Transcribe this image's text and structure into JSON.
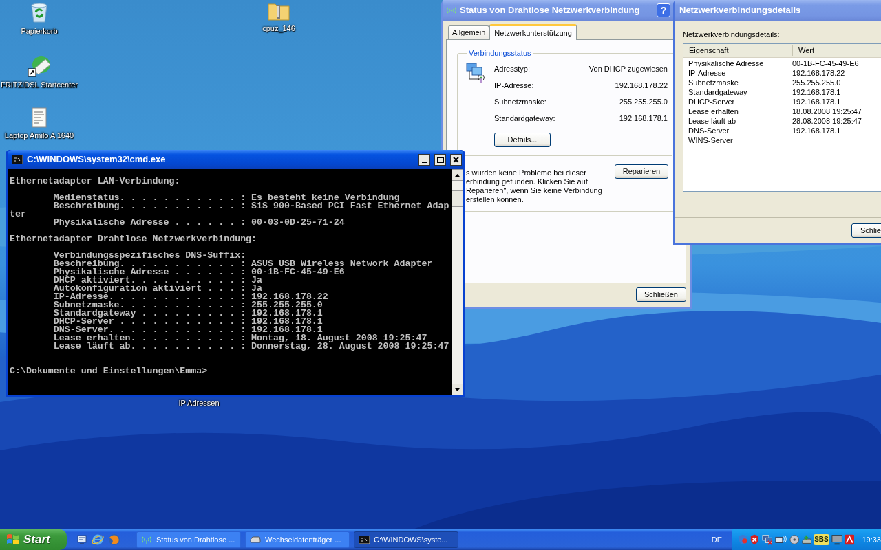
{
  "desktop": {
    "icons": [
      {
        "label": "Papierkorb",
        "kind": "recycle"
      },
      {
        "label": "cpuz_146",
        "kind": "zip"
      },
      {
        "label": "FRITZ!DSL Startcenter",
        "kind": "shortcut"
      },
      {
        "label": "Laptop Amilo A 1640",
        "kind": "document"
      },
      {
        "label": "IP Adressen",
        "kind": "hidden"
      }
    ]
  },
  "status_window": {
    "title": "Status von Drahtlose Netzwerkverbindung",
    "active": false,
    "help_button": "?",
    "tabs": [
      {
        "label": "Allgemein",
        "selected": false
      },
      {
        "label": "Netzwerkunterstützung",
        "selected": true
      }
    ],
    "group_title": "Verbindungsstatus",
    "fields": [
      {
        "label": "Adresstyp:",
        "value": "Von DHCP zugewiesen"
      },
      {
        "label": "IP-Adresse:",
        "value": "192.168.178.22"
      },
      {
        "label": "Subnetzmaske:",
        "value": "255.255.255.0"
      },
      {
        "label": "Standardgateway:",
        "value": "192.168.178.1"
      }
    ],
    "details_button": "Details...",
    "problem_text": [
      "s wurden keine Probleme bei dieser",
      "erbindung gefunden. Klicken Sie auf",
      "Reparieren\", wenn Sie keine Verbindung",
      "erstellen können."
    ],
    "repair_button": "Reparieren",
    "close_button": "Schließen"
  },
  "details_window": {
    "title": "Netzwerkverbindungsdetails",
    "active": false,
    "caption": "Netzwerkverbindungsdetails:",
    "columns": [
      "Eigenschaft",
      "Wert"
    ],
    "rows": [
      {
        "property": "Physikalische Adresse",
        "value": "00-1B-FC-45-49-E6"
      },
      {
        "property": "IP-Adresse",
        "value": "192.168.178.22"
      },
      {
        "property": "Subnetzmaske",
        "value": "255.255.255.0"
      },
      {
        "property": "Standardgateway",
        "value": "192.168.178.1"
      },
      {
        "property": "DHCP-Server",
        "value": "192.168.178.1"
      },
      {
        "property": "Lease erhalten",
        "value": "18.08.2008 19:25:47"
      },
      {
        "property": "Lease läuft ab",
        "value": "28.08.2008 19:25:47"
      },
      {
        "property": "DNS-Server",
        "value": "192.168.178.1"
      },
      {
        "property": "WINS-Server"
      }
    ],
    "close_button": "Schlie"
  },
  "console_window": {
    "title": "C:\\WINDOWS\\system32\\cmd.exe",
    "active": true,
    "output": "Ethernetadapter LAN-Verbindung:\n\n        Medienstatus. . . . . . . . . . . : Es besteht keine Verbindung\n        Beschreibung. . . . . . . . . . . : SiS 900-Based PCI Fast Ethernet Adap\nter\n        Physikalische Adresse . . . . . . : 00-03-0D-25-71-24\n\nEthernetadapter Drahtlose Netzwerkverbindung:\n\n        Verbindungsspezifisches DNS-Suffix:\n        Beschreibung. . . . . . . . . . . : ASUS USB Wireless Network Adapter\n        Physikalische Adresse . . . . . . : 00-1B-FC-45-49-E6\n        DHCP aktiviert. . . . . . . . . . : Ja\n        Autokonfiguration aktiviert . . . : Ja\n        IP-Adresse. . . . . . . . . . . . : 192.168.178.22\n        Subnetzmaske. . . . . . . . . . . : 255.255.255.0\n        Standardgateway . . . . . . . . . : 192.168.178.1\n        DHCP-Server . . . . . . . . . . . : 192.168.178.1\n        DNS-Server. . . . . . . . . . . . : 192.168.178.1\n        Lease erhalten. . . . . . . . . . : Montag, 18. August 2008 19:25:47\n        Lease läuft ab. . . . . . . . . . : Donnerstag, 28. August 2008 19:25:47\n\n\nC:\\Dokumente und Einstellungen\\Emma>"
  },
  "taskbar": {
    "start": "Start",
    "tasks": [
      {
        "label": "Status von Drahtlose ...",
        "kind": "wireless",
        "selected": false
      },
      {
        "label": "Wechseldatenträger ...",
        "kind": "drive",
        "selected": false
      },
      {
        "label": "C:\\WINDOWS\\syste...",
        "kind": "console",
        "selected": true
      }
    ],
    "language": "DE",
    "tray_label": "SBS",
    "clock": "19:33"
  }
}
